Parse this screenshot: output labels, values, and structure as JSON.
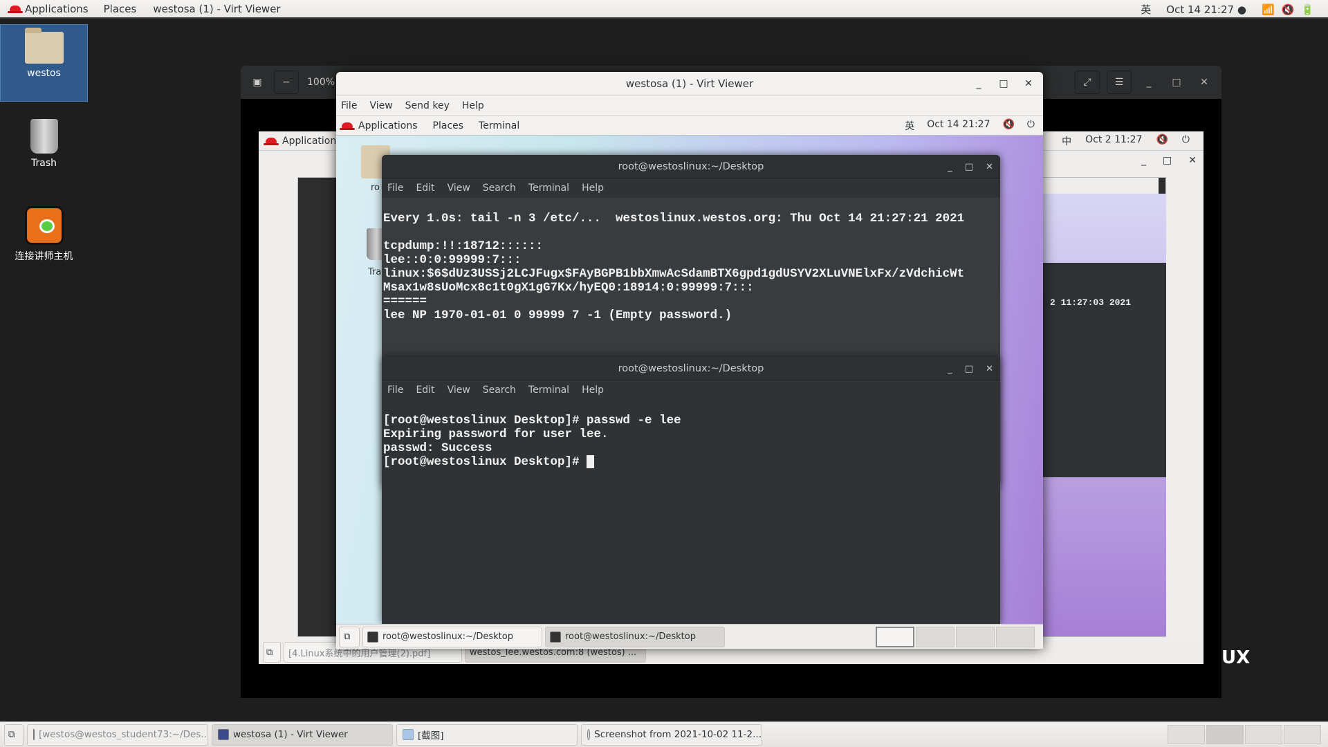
{
  "top_panel": {
    "applications": "Applications",
    "places": "Places",
    "active_window": "westosa (1) - Virt Viewer",
    "input_method": "英",
    "datetime": "Oct 14  21:27",
    "icons": [
      "wifi-icon",
      "volume-muted-icon",
      "battery-charging-icon"
    ]
  },
  "desktop_icons": [
    {
      "label": "westos",
      "icon": "home-folder-icon",
      "selected": true
    },
    {
      "label": "Trash",
      "icon": "trash-icon",
      "selected": false
    },
    {
      "label": "连接讲师主机",
      "icon": "remote-connect-icon",
      "selected": false
    }
  ],
  "outer_viewer": {
    "zoom": "100%",
    "lux_text": "UX"
  },
  "nested_vm": {
    "applications": "Applications",
    "input_method": "中",
    "datetime": "Oct 2  11:27",
    "datetime2": "2  11:27",
    "datetime3": "Oct 2  11:27",
    "term_time": "2 11:27:03 2021",
    "taskbar": [
      {
        "label": "[4.Linux系统中的用户管理(2).pdf]"
      },
      {
        "label": "westos_lee.westos.com:8 (westos) ..."
      }
    ]
  },
  "virt_viewer": {
    "title": "westosa (1) - Virt Viewer",
    "menu": [
      "File",
      "View",
      "Send key",
      "Help"
    ],
    "guest_panel": {
      "applications": "Applications",
      "places": "Places",
      "terminal": "Terminal",
      "input_method": "英",
      "datetime": "Oct 14  21:27"
    },
    "guest_desktop_icons": [
      "ro",
      "Tra"
    ],
    "terminals": [
      {
        "title": "root@westoslinux:~/Desktop",
        "menu": [
          "File",
          "Edit",
          "View",
          "Search",
          "Terminal",
          "Help"
        ],
        "lines": [
          "Every 1.0s: tail -n 3 /etc/...  westoslinux.westos.org: Thu Oct 14 21:27:21 2021",
          "",
          "tcpdump:!!:18712::::::",
          "lee::0:0:99999:7:::",
          "linux:$6$dUz3USSj2LCJFugx$FAyBGPB1bbXmwAcSdamBTX6gpd1gdUSYV2XLuVNElxFx/zVdchicWt",
          "Msax1w8sUoMcx8c1t0gX1gG7Kx/hyEQ0:18914:0:99999:7:::",
          "======",
          "lee NP 1970-01-01 0 99999 7 -1 (Empty password.)"
        ]
      },
      {
        "title": "root@westoslinux:~/Desktop",
        "menu": [
          "File",
          "Edit",
          "View",
          "Search",
          "Terminal",
          "Help"
        ],
        "lines": [
          "[root@westoslinux Desktop]# passwd -e lee",
          "Expiring password for user lee.",
          "passwd: Success",
          "[root@westoslinux Desktop]# "
        ]
      }
    ],
    "guest_taskbar": [
      {
        "label": "root@westoslinux:~/Desktop",
        "active": false
      },
      {
        "label": "root@westoslinux:~/Desktop",
        "active": true
      }
    ]
  },
  "bottom_taskbar": [
    {
      "label": "[westos@westos_student73:~/Des...",
      "icon": "terminal-icon",
      "active": false
    },
    {
      "label": "westosa (1) - Virt Viewer",
      "icon": "virt-viewer-icon",
      "active": true
    },
    {
      "label": "[截图]",
      "icon": "document-icon",
      "active": false
    },
    {
      "label": "Screenshot from 2021-10-02 11-2...",
      "icon": "image-viewer-icon",
      "active": false
    }
  ]
}
